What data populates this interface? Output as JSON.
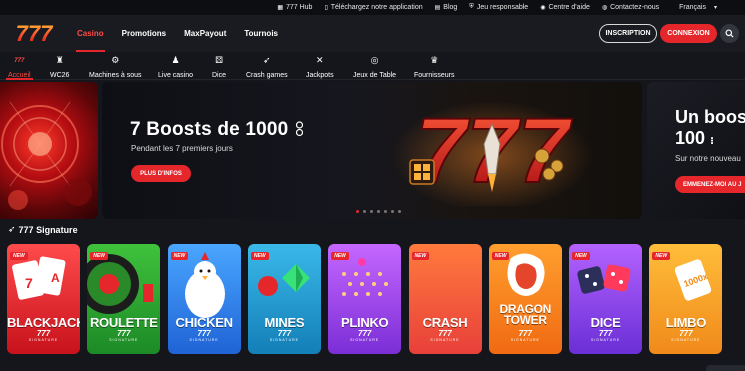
{
  "topbar": {
    "items": [
      {
        "label": "777 Hub",
        "icon": "grid-icon"
      },
      {
        "label": "Téléchargez notre application",
        "icon": "phone-icon"
      },
      {
        "label": "Blog",
        "icon": "book-icon"
      },
      {
        "label": "Jeu responsable",
        "icon": "shield-icon"
      },
      {
        "label": "Centre d'aide",
        "icon": "user-icon"
      },
      {
        "label": "Contactez-nous",
        "icon": "chat-icon"
      }
    ],
    "language": "Français"
  },
  "logo": {
    "text": "777"
  },
  "mainnav": {
    "items": [
      "Casino",
      "Promotions",
      "MaxPayout",
      "Tournois"
    ],
    "active": "Casino"
  },
  "auth": {
    "register": "INSCRIPTION",
    "login": "CONNEXION"
  },
  "categories": {
    "items": [
      {
        "label": "Accueil",
        "icon": "home-777-icon"
      },
      {
        "label": "WC26",
        "icon": "trophy-icon"
      },
      {
        "label": "Machines à sous",
        "icon": "slot-machine-icon"
      },
      {
        "label": "Live casino",
        "icon": "dealer-icon"
      },
      {
        "label": "Dice",
        "icon": "dice-icon"
      },
      {
        "label": "Crash games",
        "icon": "rocket-icon"
      },
      {
        "label": "Jackpots",
        "icon": "jackpot-icon"
      },
      {
        "label": "Jeux de Table",
        "icon": "chip-icon"
      },
      {
        "label": "Fournisseurs",
        "icon": "crown-icon"
      }
    ]
  },
  "banner": {
    "title": "7 Boosts de 1000",
    "subtitle": "Pendant les 7 premiers jours",
    "cta": "PLUS D'INFOS",
    "art_text": "777",
    "slides": 7,
    "active_slide": 1
  },
  "banner_next": {
    "title_line1": "Un boos",
    "title_line2": "100",
    "subtitle": "Sur notre nouveau",
    "cta": "EMMENEZ-MOI AU J"
  },
  "signature": {
    "title": "777 Signature",
    "badge": "NEW",
    "brand": "777",
    "tagline": "SIGNATURE",
    "games": [
      {
        "name": "BLACKJACK",
        "color_top": "#ff4b4b",
        "color_bottom": "#c8121c"
      },
      {
        "name": "ROULETTE",
        "color_top": "#3fc23c",
        "color_bottom": "#1c8a26"
      },
      {
        "name": "CHICKEN",
        "color_top": "#4aa6ff",
        "color_bottom": "#1f63d6"
      },
      {
        "name": "MINES",
        "color_top": "#3ab8e8",
        "color_bottom": "#137fb8"
      },
      {
        "name": "PLINKO",
        "color_top": "#c567ff",
        "color_bottom": "#7b2ed6"
      },
      {
        "name": "CRASH",
        "color_top": "#ff7a3d",
        "color_bottom": "#e8403a"
      },
      {
        "name": "DRAGON TOWER",
        "color_top": "#ff9f2e",
        "color_bottom": "#f06a12"
      },
      {
        "name": "DICE",
        "color_top": "#b462ff",
        "color_bottom": "#6a2fd6"
      },
      {
        "name": "LIMBO",
        "color_top": "#ffbd3a",
        "color_bottom": "#f08a1a"
      }
    ]
  },
  "colors": {
    "accent": "#e5262b",
    "background": "#15161b"
  }
}
